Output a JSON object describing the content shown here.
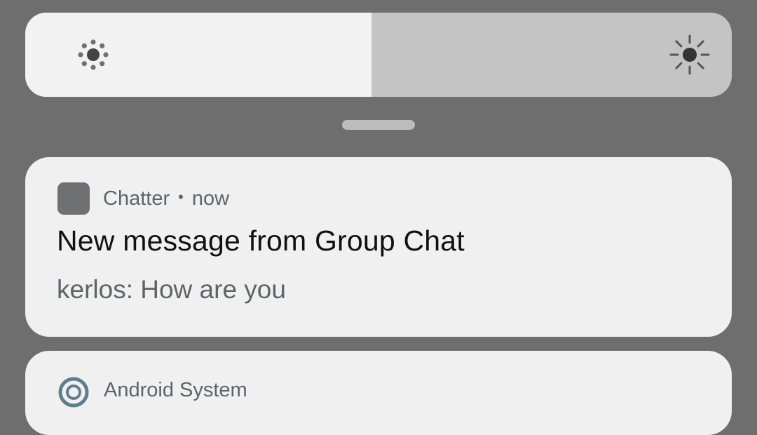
{
  "brightness": {
    "level": 0.49,
    "low_icon": "brightness-low-icon",
    "high_icon": "brightness-high-icon",
    "fill_color": "#f2f2f2",
    "track_color": "#c4c4c4"
  },
  "notification": {
    "app_icon": "app-placeholder-icon",
    "app_name": "Chatter",
    "separator": "•",
    "time": "now",
    "title": "New message from Group Chat",
    "body": "kerlos: How are you"
  },
  "next_notification": {
    "app_icon": "android-system-icon",
    "app_name": "Android System"
  }
}
